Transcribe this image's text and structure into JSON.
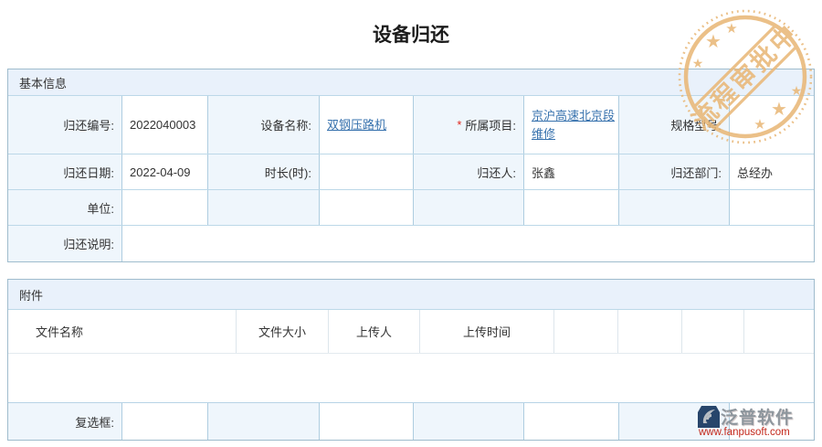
{
  "page": {
    "title": "设备归还"
  },
  "stamp": {
    "text": "流程审批中",
    "star": "★",
    "color": "#e9b878"
  },
  "basic_info": {
    "section_title": "基本信息",
    "fields": {
      "return_no": {
        "label": "归还编号:",
        "value": "2022040003"
      },
      "device_name": {
        "label": "设备名称:",
        "value": "双钢压路机"
      },
      "project": {
        "required_mark": "*",
        "label": "所属项目:",
        "value": "京沪高速北京段维修"
      },
      "spec_model": {
        "label": "规格型号:",
        "value": ""
      },
      "return_date": {
        "label": "归还日期:",
        "value": "2022-04-09"
      },
      "duration": {
        "label": "时长(时):",
        "value": ""
      },
      "returner": {
        "label": "归还人:",
        "value": "张鑫"
      },
      "return_dept": {
        "label": "归还部门:",
        "value": "总经办"
      },
      "unit": {
        "label": "单位:",
        "value": ""
      },
      "return_note": {
        "label": "归还说明:",
        "value": ""
      }
    }
  },
  "attachments": {
    "section_title": "附件",
    "columns": {
      "file_name": "文件名称",
      "file_size": "文件大小",
      "uploader": "上传人",
      "upload_time": "上传时间"
    },
    "checkbox_label": "复选框:"
  },
  "brand": {
    "name": "泛普软件",
    "url": "www.fanpusoft.com"
  }
}
